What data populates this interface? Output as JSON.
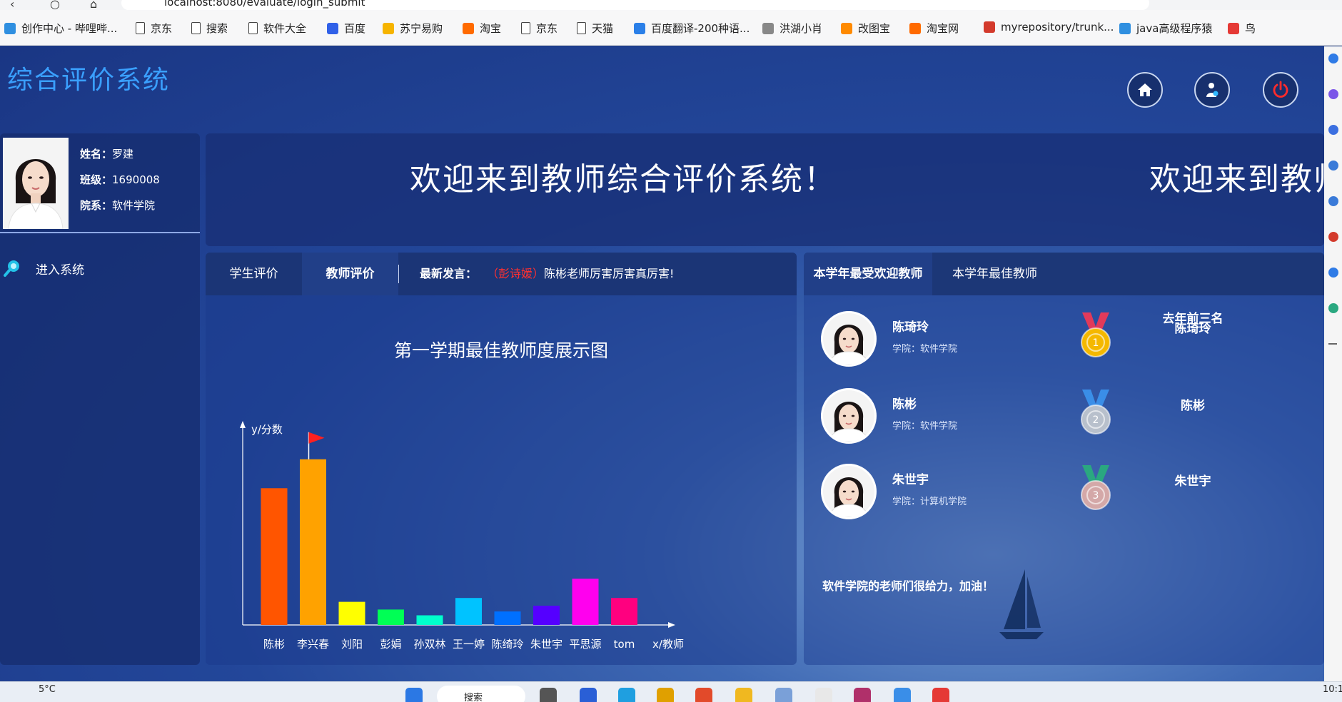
{
  "browser": {
    "url": "localhost:8080/evaluate/login_submit",
    "bookmarks": [
      {
        "label": "创作中心 - 哔哩哔...",
        "color": "#2f8fe0"
      },
      {
        "label": "京东",
        "color": "doc"
      },
      {
        "label": "搜索",
        "color": "doc"
      },
      {
        "label": "软件大全",
        "color": "doc"
      },
      {
        "label": "百度",
        "color": "#3060e8"
      },
      {
        "label": "苏宁易购",
        "color": "#f6b400"
      },
      {
        "label": "淘宝",
        "color": "#ff6a00"
      },
      {
        "label": "京东",
        "color": "doc"
      },
      {
        "label": "天猫",
        "color": "doc"
      },
      {
        "label": "百度翻译-200种语...",
        "color": "#2a7fe8"
      },
      {
        "label": "洪湖小肖",
        "color": "#888888"
      },
      {
        "label": "改图宝",
        "color": "#ff8a00"
      },
      {
        "label": "淘宝网",
        "color": "#ff6a00"
      },
      {
        "label": "myrepository/trunk...",
        "color": "#d33a2c"
      },
      {
        "label": "java高级程序猿",
        "color": "#2f8fe0"
      },
      {
        "label": "鸟",
        "color": "#e53935"
      }
    ]
  },
  "app": {
    "title": "综合评价系统",
    "header_icons": [
      "home-icon",
      "user-icon",
      "power-icon"
    ]
  },
  "user": {
    "name_label": "姓名：",
    "name": "罗建",
    "class_label": "班级：",
    "class": "1690008",
    "dept_label": "院系：",
    "dept": "软件学院",
    "enter_label": "进入系统"
  },
  "welcome": {
    "text": "欢迎来到教师综合评价系统！",
    "text_repeat": "欢迎来到教师"
  },
  "eval_tabs": {
    "tabs": [
      "学生评价",
      "教师评价"
    ],
    "active": 1,
    "latest_label": "最新发言：",
    "latest_who": "（彭诗媛）",
    "latest_msg": "陈彬老师厉害厉害真厉害!"
  },
  "chart_data": {
    "type": "bar",
    "title": "第一学期最佳教师度展示图",
    "ylabel": "y/分数",
    "xlabel": "x/教师",
    "categories": [
      "陈彬",
      "李兴春",
      "刘阳",
      "彭娟",
      "孙双林",
      "王一婷",
      "陈绮玲",
      "朱世宇",
      "平思源",
      "tom"
    ],
    "values": [
      71,
      86,
      12,
      8,
      5,
      14,
      7,
      10,
      24,
      14
    ],
    "colors": [
      "#ff5500",
      "#ffa200",
      "#ffff00",
      "#00ff55",
      "#00ffcc",
      "#00c3ff",
      "#0070ff",
      "#5500ff",
      "#ff00ee",
      "#ff007f"
    ],
    "ylim": [
      0,
      100
    ],
    "flag_on": 1,
    "grid": false
  },
  "teacher_panel": {
    "tabs": [
      "本学年最受欢迎教师",
      "本学年最佳教师"
    ],
    "active": 0,
    "last_year_title": "去年前三名",
    "teachers": [
      {
        "name": "陈琦玲",
        "school": "学院：软件学院",
        "rank": "1",
        "medal_color": "#f5b800",
        "ribbon": "#e23a5a"
      },
      {
        "name": "陈彬",
        "school": "学院：软件学院",
        "rank": "2",
        "medal_color": "#b8c0cc",
        "ribbon": "#3a8ee8"
      },
      {
        "name": "朱世宇",
        "school": "学院：计算机学院",
        "rank": "3",
        "medal_color": "#d4a8a8",
        "ribbon": "#2aa880"
      }
    ],
    "last_year": [
      "陈琦玲",
      "陈彬",
      "朱世宇"
    ],
    "slogan": "软件学院的老师们很给力，加油！"
  },
  "taskbar": {
    "weather": "5°C",
    "search_label": "搜索",
    "time": "10:1"
  }
}
